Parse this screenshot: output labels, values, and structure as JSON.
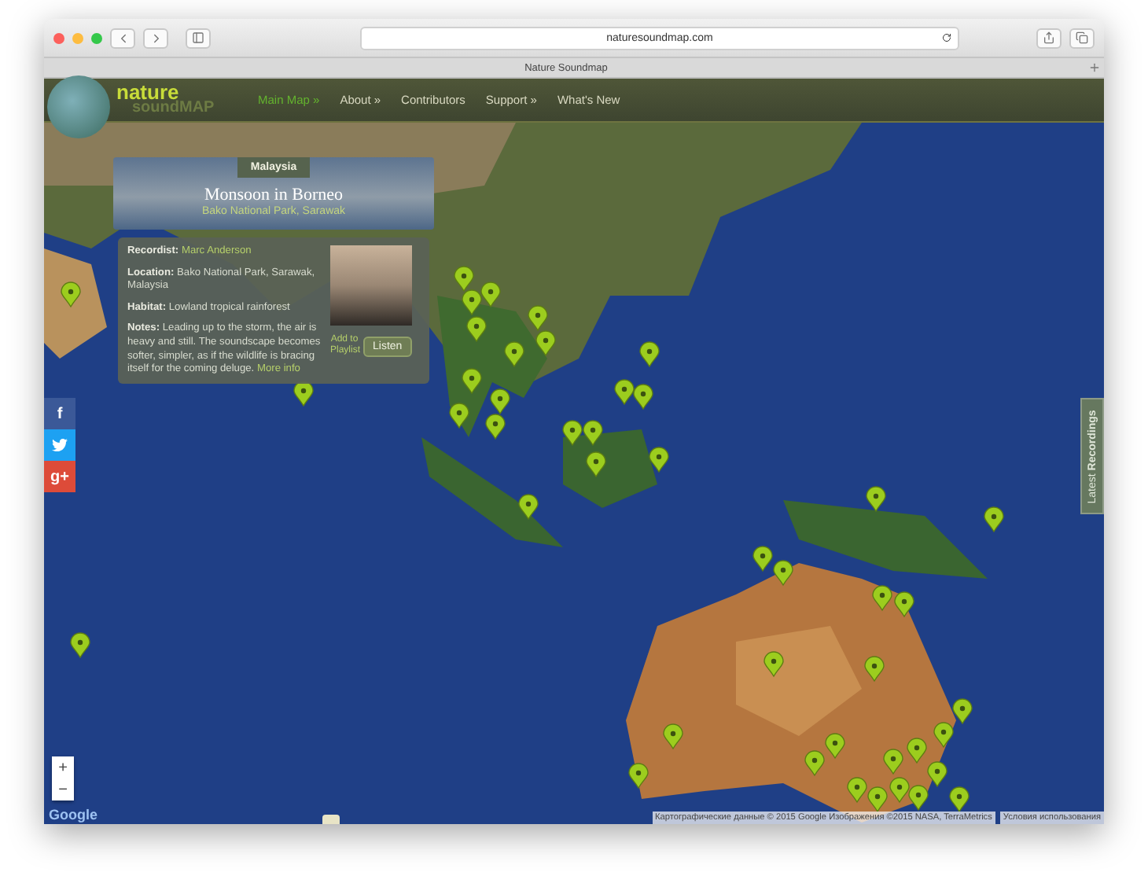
{
  "browser": {
    "url": "naturesoundmap.com",
    "tab_title": "Nature Soundmap"
  },
  "logo": {
    "line_1": "nature",
    "line_2": "soundMAP"
  },
  "nav": [
    {
      "label": "Main Map »",
      "selected": true
    },
    {
      "label": "About »",
      "selected": false
    },
    {
      "label": "Contributors",
      "selected": false
    },
    {
      "label": "Support »",
      "selected": false
    },
    {
      "label": "What's New",
      "selected": false
    }
  ],
  "popup": {
    "country": "Malaysia",
    "title": "Monsoon in Borneo",
    "place": "Bako National Park, Sarawak",
    "fields": [
      {
        "label": "Recordist:",
        "value": "Marc Anderson",
        "kind": "link"
      },
      {
        "label": "Location:",
        "value": "Bako National Park, Sarawak, Malaysia",
        "kind": "text"
      },
      {
        "label": "Habitat:",
        "value": "Lowland tropical rainforest",
        "kind": "text"
      },
      {
        "label": "Notes:",
        "value": "Leading up to the storm, the air is heavy and still. The soundscape becomes softer, simpler, as if the wildlife is bracing itself for the coming deluge.",
        "kind": "text",
        "link": "More info"
      }
    ],
    "add_to_playlist": "Add to Playlist",
    "listen": "Listen"
  },
  "social": [
    {
      "kind": "facebook",
      "label": "f"
    },
    {
      "kind": "twitter"
    },
    {
      "kind": "google",
      "label": "g+"
    }
  ],
  "side_tab": {
    "prefix": "Latest",
    "label": "Recordings"
  },
  "zoom": {
    "in": "+",
    "out": "−"
  },
  "map_logo": "Google",
  "attribution": {
    "data": "Картографические данные © 2015 Google Изображения ©2015 NASA, TerraMetrics",
    "terms": "Условия использования"
  }
}
